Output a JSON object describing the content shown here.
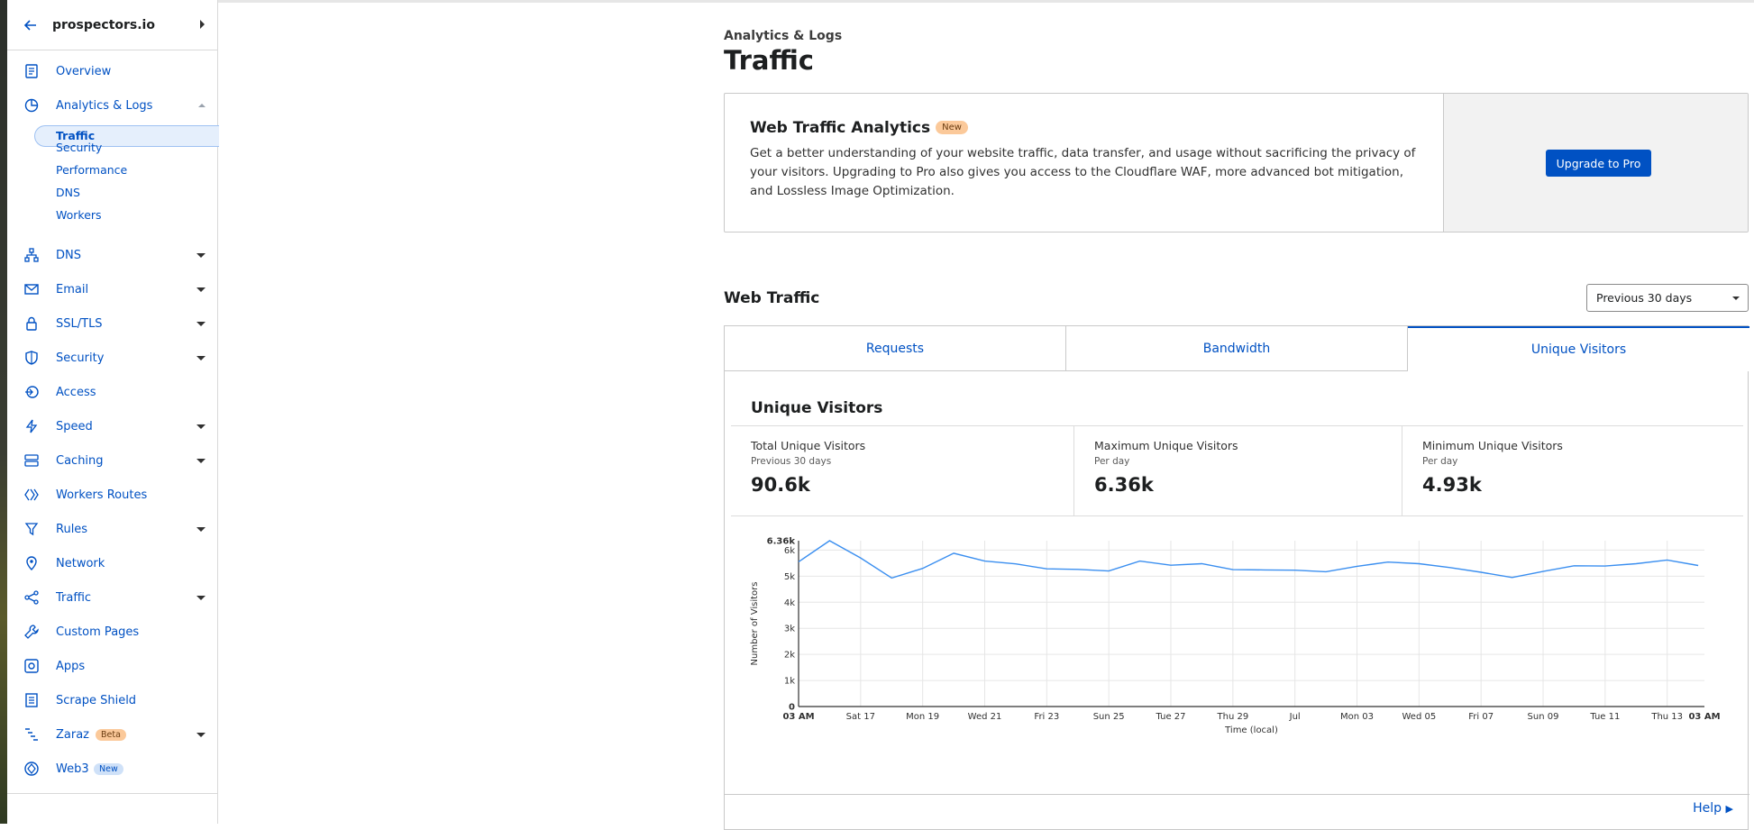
{
  "sidebar": {
    "site": "prospectors.io",
    "items": [
      {
        "label": "Overview",
        "icon": "clipboard-icon"
      },
      {
        "label": "Analytics & Logs",
        "icon": "pie-chart-icon"
      },
      {
        "label": "DNS",
        "icon": "network-tree-icon"
      },
      {
        "label": "Email",
        "icon": "envelope-icon"
      },
      {
        "label": "SSL/TLS",
        "icon": "lock-icon"
      },
      {
        "label": "Security",
        "icon": "shield-icon"
      },
      {
        "label": "Access",
        "icon": "access-icon"
      },
      {
        "label": "Speed",
        "icon": "lightning-icon"
      },
      {
        "label": "Caching",
        "icon": "server-stack-icon"
      },
      {
        "label": "Workers Routes",
        "icon": "workers-icon"
      },
      {
        "label": "Rules",
        "icon": "funnel-icon"
      },
      {
        "label": "Network",
        "icon": "location-pin-icon"
      },
      {
        "label": "Traffic",
        "icon": "traffic-icon"
      },
      {
        "label": "Custom Pages",
        "icon": "wrench-icon"
      },
      {
        "label": "Apps",
        "icon": "apps-icon"
      },
      {
        "label": "Scrape Shield",
        "icon": "document-icon"
      },
      {
        "label": "Zaraz",
        "icon": "zaraz-icon",
        "badge": "Beta"
      },
      {
        "label": "Web3",
        "icon": "web3-icon",
        "badge": "New"
      }
    ],
    "analytics_sub": [
      "Traffic",
      "Security",
      "Performance",
      "DNS",
      "Workers"
    ]
  },
  "header": {
    "breadcrumb": "Analytics & Logs",
    "title": "Traffic"
  },
  "promo": {
    "title": "Web Traffic Analytics",
    "badge": "New",
    "text": "Get a better understanding of your website traffic, data transfer, and usage without sacrificing the privacy of your visitors. Upgrading to Pro also gives you access to the Cloudflare WAF, more advanced bot mitigation, and Lossless Image Optimization.",
    "button": "Upgrade to Pro"
  },
  "web_traffic": {
    "title": "Web Traffic",
    "range": "Previous 30 days",
    "tabs": [
      "Requests",
      "Bandwidth",
      "Unique Visitors"
    ],
    "active_tab": 2,
    "section_title": "Unique Visitors",
    "stats": [
      {
        "label": "Total Unique Visitors",
        "sub": "Previous 30 days",
        "value": "90.6k"
      },
      {
        "label": "Maximum Unique Visitors",
        "sub": "Per day",
        "value": "6.36k"
      },
      {
        "label": "Minimum Unique Visitors",
        "sub": "Per day",
        "value": "4.93k"
      }
    ],
    "help": "Help"
  },
  "chart_data": {
    "type": "line",
    "ylabel": "Number of Visitors",
    "xlabel": "Time (local)",
    "ylim": [
      0,
      6360
    ],
    "y_ticks": [
      "0",
      "1k",
      "2k",
      "3k",
      "4k",
      "5k",
      "6k",
      "6.36k"
    ],
    "x_ticks": [
      "03 AM",
      "Sat 17",
      "Mon 19",
      "Wed 21",
      "Fri 23",
      "Sun 25",
      "Tue 27",
      "Thu 29",
      "Jul",
      "Mon 03",
      "Wed 05",
      "Fri 07",
      "Sun 09",
      "Tue 11",
      "Thu 13",
      "03 AM"
    ],
    "series": [
      {
        "color": "#3b8ff0",
        "values": [
          5550,
          6360,
          5700,
          4930,
          5300,
          5880,
          5580,
          5470,
          5280,
          5260,
          5200,
          5580,
          5420,
          5480,
          5250,
          5240,
          5230,
          5170,
          5380,
          5540,
          5480,
          5330,
          5150,
          4950,
          5180,
          5400,
          5390,
          5480,
          5620,
          5410
        ]
      }
    ],
    "grid": true
  }
}
